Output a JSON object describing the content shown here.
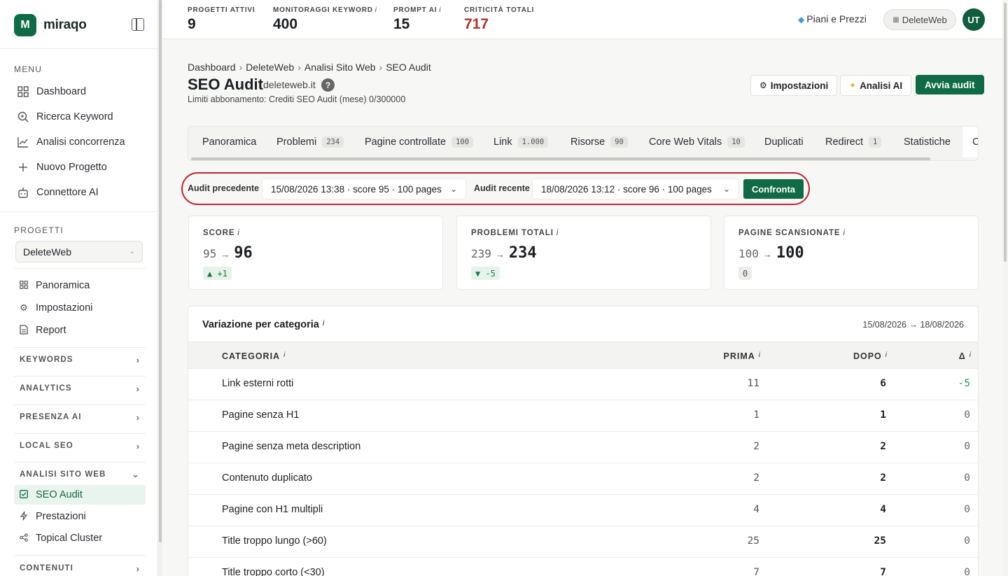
{
  "brand": {
    "logo_letter": "M",
    "name": "miraqo"
  },
  "sidebar": {
    "menu_label": "MENU",
    "menu_items": [
      {
        "label": "Dashboard",
        "icon": "grid-icon"
      },
      {
        "label": "Ricerca Keyword",
        "icon": "search-icon"
      },
      {
        "label": "Analisi concorrenza",
        "icon": "chart-line-icon"
      },
      {
        "label": "Nuovo Progetto",
        "icon": "plus-icon"
      },
      {
        "label": "Connettore AI",
        "icon": "robot-icon"
      }
    ],
    "projects_label": "PROGETTI",
    "project_selected": "DeleteWeb",
    "project_items": [
      {
        "label": "Panoramica",
        "icon": "grid-icon"
      },
      {
        "label": "Impostazioni",
        "icon": "gear-icon"
      },
      {
        "label": "Report",
        "icon": "document-icon"
      }
    ],
    "groups": {
      "keywords": "KEYWORDS",
      "analytics": "ANALYTICS",
      "presenza_ai": "PRESENZA AI",
      "local_seo": "LOCAL SEO",
      "analisi_sito_web": "ANALISI SITO WEB",
      "contenuti": "CONTENUTI"
    },
    "analisi_items": [
      {
        "label": "SEO Audit",
        "icon": "check-square-icon"
      },
      {
        "label": "Prestazioni",
        "icon": "bolt-icon"
      },
      {
        "label": "Topical Cluster",
        "icon": "share-icon"
      }
    ]
  },
  "topbar": {
    "kpis": [
      {
        "label": "PROGETTI ATTIVI",
        "value": "9",
        "info": ""
      },
      {
        "label": "MONITORAGGI KEYWORD",
        "value": "400",
        "info": "i"
      },
      {
        "label": "PROMPT AI",
        "value": "15",
        "info": "i"
      },
      {
        "label": "CRITICITÀ TOTALI",
        "value": "717",
        "info": ""
      }
    ],
    "plans_label": "Piani e Prezzi",
    "workspace_label": "DeleteWeb",
    "avatar_initials": "UT"
  },
  "header": {
    "breadcrumb": [
      "Dashboard",
      "DeleteWeb",
      "Analisi Sito Web",
      "SEO Audit"
    ],
    "title": "SEO Audit",
    "domain": "deleteweb.it",
    "help": "?",
    "limits": "Limiti abbonamento: Crediti SEO Audit (mese) 0/300000",
    "buttons": {
      "settings": "Impostazioni",
      "ai": "Analisi AI",
      "start": "Avvia audit"
    }
  },
  "tabs": [
    {
      "label": "Panoramica",
      "badge": ""
    },
    {
      "label": "Problemi",
      "badge": "234"
    },
    {
      "label": "Pagine controllate",
      "badge": "100"
    },
    {
      "label": "Link",
      "badge": "1.000"
    },
    {
      "label": "Risorse",
      "badge": "90"
    },
    {
      "label": "Core Web Vitals",
      "badge": "10"
    },
    {
      "label": "Duplicati",
      "badge": ""
    },
    {
      "label": "Redirect",
      "badge": "1"
    },
    {
      "label": "Statistiche",
      "badge": ""
    },
    {
      "label": "C",
      "badge": ""
    }
  ],
  "compare": {
    "previous_label": "Audit precedente",
    "previous_value": "15/08/2026 13:38 · score 95 · 100 pages",
    "recent_label": "Audit recente",
    "recent_value": "18/08/2026 13:12 · score 96 · 100 pages",
    "button": "Confronta"
  },
  "cards": [
    {
      "label": "SCORE",
      "info": "i",
      "from": "95",
      "to": "96",
      "delta": "▲ +1"
    },
    {
      "label": "PROBLEMI TOTALI",
      "info": "i",
      "from": "239",
      "to": "234",
      "delta": "▼ -5"
    },
    {
      "label": "PAGINE SCANSIONATE",
      "info": "i",
      "from": "100",
      "to": "100",
      "delta": "0"
    }
  ],
  "arrow": "→",
  "table": {
    "title": "Variazione per categoria",
    "info": "i",
    "range": "15/08/2026 → 18/08/2026",
    "headers": {
      "categoria": "CATEGORIA",
      "prima": "PRIMA",
      "dopo": "DOPO",
      "delta": "Δ"
    },
    "rows": [
      {
        "categoria": "Link esterni rotti",
        "prima": "11",
        "dopo": "6",
        "delta": "-5"
      },
      {
        "categoria": "Pagine senza H1",
        "prima": "1",
        "dopo": "1",
        "delta": "0"
      },
      {
        "categoria": "Pagine senza meta description",
        "prima": "2",
        "dopo": "2",
        "delta": "0"
      },
      {
        "categoria": "Contenuto duplicato",
        "prima": "2",
        "dopo": "2",
        "delta": "0"
      },
      {
        "categoria": "Pagine con H1 multipli",
        "prima": "4",
        "dopo": "4",
        "delta": "0"
      },
      {
        "categoria": "Title troppo lungo (>60)",
        "prima": "25",
        "dopo": "25",
        "delta": "0"
      },
      {
        "categoria": "Title troppo corto (<30)",
        "prima": "7",
        "dopo": "7",
        "delta": "0"
      }
    ]
  },
  "colors": {
    "brand": "#0f6b45",
    "critical": "#b0312a",
    "highlight": "#c0262d",
    "positive": "#1e9a5a"
  }
}
